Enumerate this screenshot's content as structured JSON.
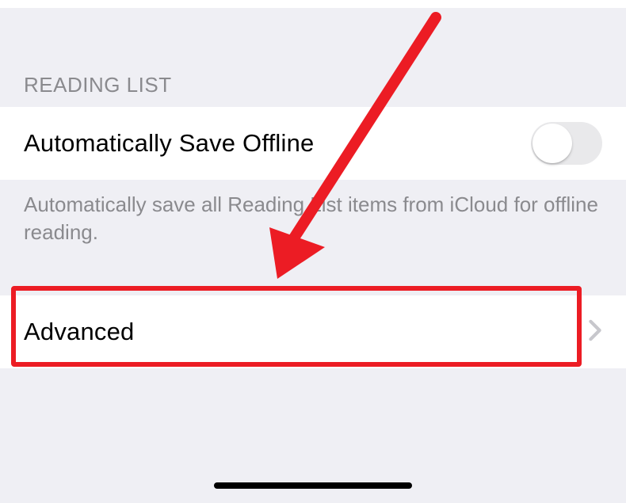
{
  "section": {
    "header": "READING LIST",
    "footer": "Automatically save all Reading List items from iCloud for offline reading."
  },
  "toggleRow": {
    "label": "Automatically Save Offline",
    "enabled": false
  },
  "advancedRow": {
    "label": "Advanced"
  },
  "annotation": {
    "highlightColor": "#ec1c24"
  }
}
